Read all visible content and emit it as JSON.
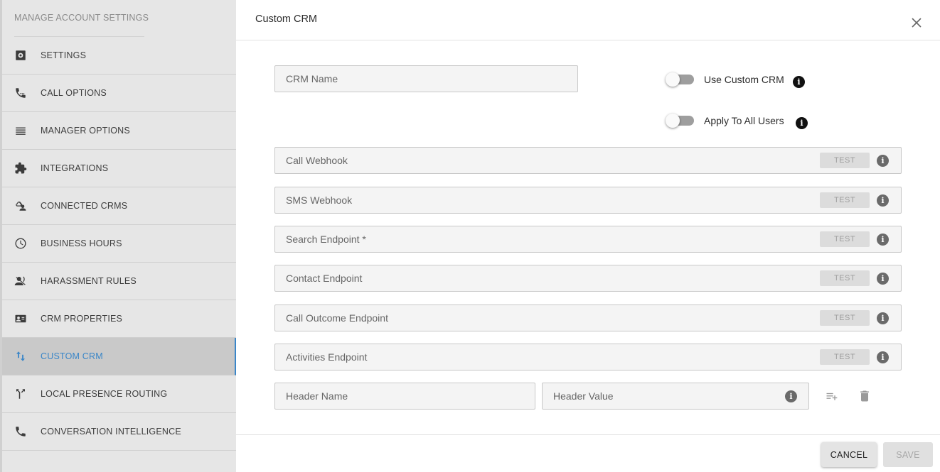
{
  "sidebar": {
    "header": "MANAGE ACCOUNT SETTINGS",
    "items": [
      {
        "label": "SETTINGS",
        "icon": "gear-icon"
      },
      {
        "label": "CALL OPTIONS",
        "icon": "phone-dial-icon"
      },
      {
        "label": "MANAGER OPTIONS",
        "icon": "menu-lines-icon"
      },
      {
        "label": "INTEGRATIONS",
        "icon": "puzzle-icon"
      },
      {
        "label": "CONNECTED CRMS",
        "icon": "cloud-person-icon"
      },
      {
        "label": "BUSINESS HOURS",
        "icon": "clock-icon"
      },
      {
        "label": "HARASSMENT RULES",
        "icon": "voice-off-icon"
      },
      {
        "label": "CRM PROPERTIES",
        "icon": "contact-card-icon"
      },
      {
        "label": "CUSTOM CRM",
        "icon": "arrows-up-down-icon",
        "active": true
      },
      {
        "label": "LOCAL PRESENCE ROUTING",
        "icon": "route-split-icon"
      },
      {
        "label": "CONVERSATION INTELLIGENCE",
        "icon": "phone-icon"
      }
    ]
  },
  "modal": {
    "title": "Custom CRM",
    "crm_name_placeholder": "CRM Name",
    "toggles": {
      "use_custom_crm": "Use Custom CRM",
      "apply_to_all_users": "Apply To All Users"
    },
    "test_label": "TEST",
    "info_glyph": "i",
    "endpoints": [
      {
        "placeholder": "Call Webhook"
      },
      {
        "placeholder": "SMS Webhook"
      },
      {
        "placeholder": "Search Endpoint *"
      },
      {
        "placeholder": "Contact Endpoint"
      },
      {
        "placeholder": "Call Outcome Endpoint"
      },
      {
        "placeholder": "Activities Endpoint"
      }
    ],
    "header_name_placeholder": "Header Name",
    "header_value_placeholder": "Header Value",
    "footer": {
      "cancel_label": "CANCEL",
      "save_label": "SAVE"
    }
  },
  "colors": {
    "accent": "#3a86c8",
    "sidebar_bg": "#e6e6e6",
    "active_bg": "#c9c9c9"
  }
}
